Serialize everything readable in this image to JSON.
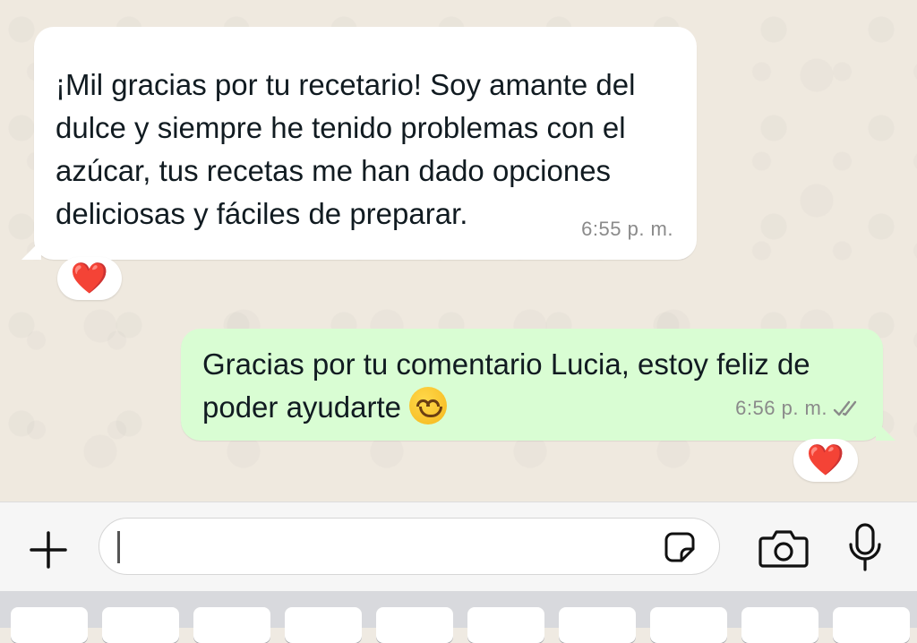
{
  "messages": [
    {
      "direction": "incoming",
      "text": "¡Mil gracias por tu recetario! Soy amante del dulce y siempre he tenido problemas con el azúcar, tus recetas me han dado opciones deliciosas y fáciles de preparar.",
      "time": "6:55 p. m.",
      "reaction": "❤️"
    },
    {
      "direction": "outgoing",
      "text": "Gracias por tu comentario Lucia, estoy feliz de poder ayudarte",
      "emoji": "smiling-face-icon",
      "time": "6:56 p. m.",
      "status": "read",
      "reaction": "❤️"
    }
  ],
  "composer": {
    "placeholder": "",
    "icons": [
      "plus-icon",
      "sticker-icon",
      "camera-icon",
      "microphone-icon"
    ]
  },
  "colors": {
    "incoming_bubble": "#ffffff",
    "outgoing_bubble": "#d9fdd3",
    "chat_background": "#efe9df",
    "reaction_heart": "#e5152a"
  }
}
